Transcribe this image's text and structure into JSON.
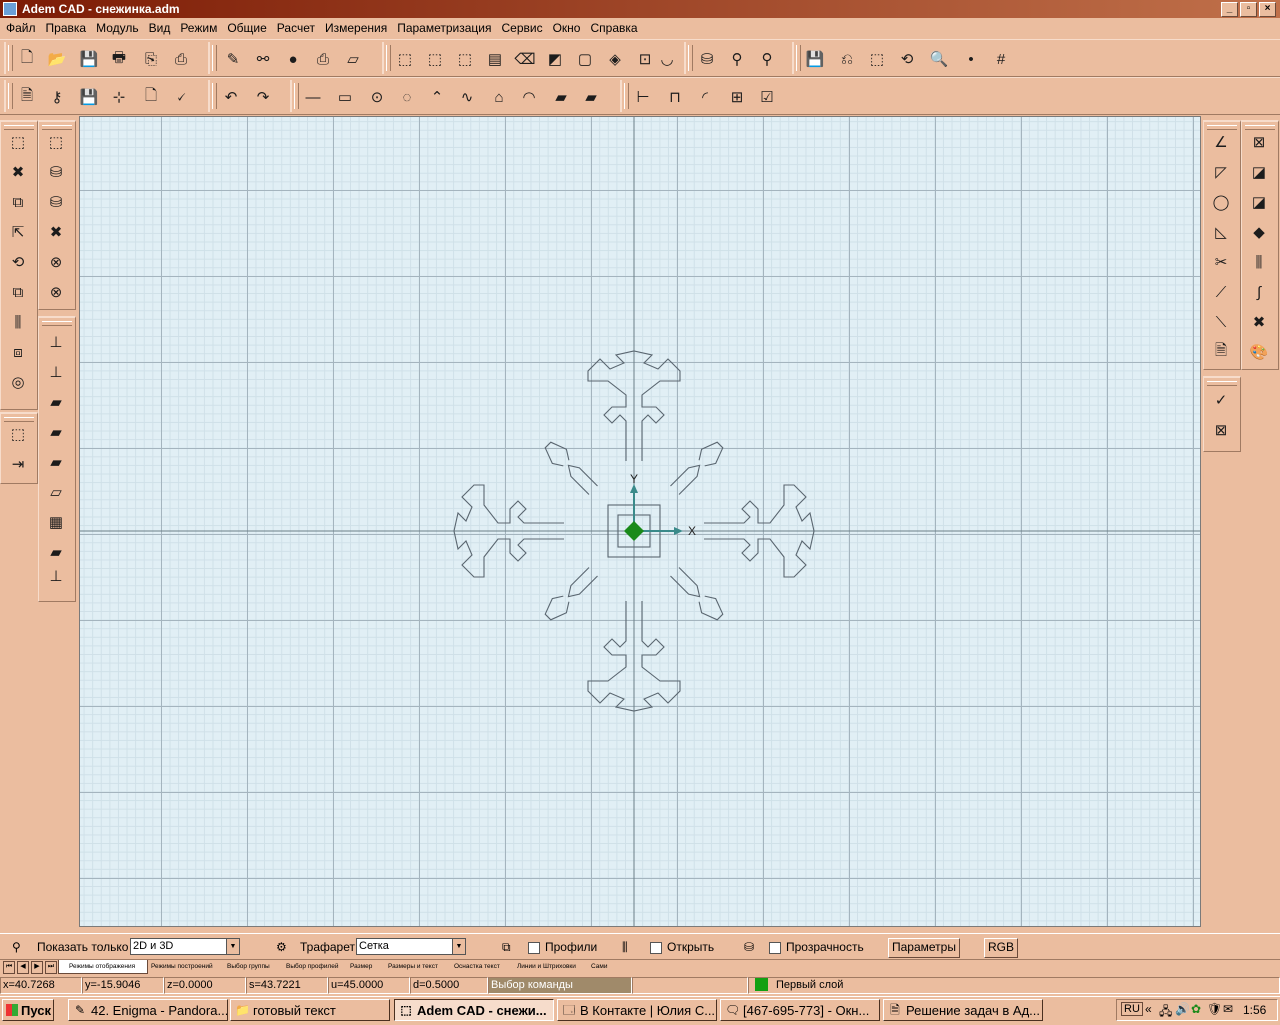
{
  "window": {
    "title": "Adem CAD - снежинка.adm",
    "buttons": [
      "_",
      "▫",
      "×"
    ]
  },
  "menu": [
    "Файл",
    "Правка",
    "Модуль",
    "Вид",
    "Режим",
    "Общие",
    "Расчет",
    "Измерения",
    "Параметризация",
    "Сервис",
    "Окно",
    "Справка"
  ],
  "canvas": {
    "axis_x": "X",
    "axis_y": "Y"
  },
  "props": {
    "show_only_label": "Показать только",
    "show_only_value": "2D и 3D",
    "stencil_label": "Трафарет",
    "stencil_value": "Сетка",
    "profiles_label": "Профили",
    "open_label": "Открыть",
    "transparency_label": "Прозрачность",
    "params_button": "Параметры",
    "rgb_button": "RGB"
  },
  "tabs": [
    "Режимы отображения",
    "Режимы построений",
    "Выбор группы",
    "Выбор профилей",
    "Размер",
    "Размеры и текст",
    "Оснастка текст",
    "Линии и Штриховки",
    "Сами"
  ],
  "status": {
    "x": "x=40.7268",
    "y": "y=-15.9046",
    "z": "z=0.0000",
    "s": "s=43.7221",
    "u": "u=45.0000",
    "d": "d=0.5000",
    "command": "Выбор команды",
    "layer": "Первый слой",
    "layer_color": "#12a012"
  },
  "taskbar": {
    "start": "Пуск",
    "tasks": [
      "42. Enigma - Pandora...",
      "готовый текст",
      "Adem CAD - снежи...",
      "В Контакте | Юлия С...",
      "[467-695-773] - Окн...",
      "Решение задач в Ад..."
    ],
    "lang": "RU",
    "time": "1:56"
  },
  "colors": {
    "accent": "#ebbd9f",
    "title_start": "#7c1b05",
    "canvas_bg": "#e1eff5",
    "drawing": "#5a6670",
    "origin": "#1a8a1a"
  }
}
